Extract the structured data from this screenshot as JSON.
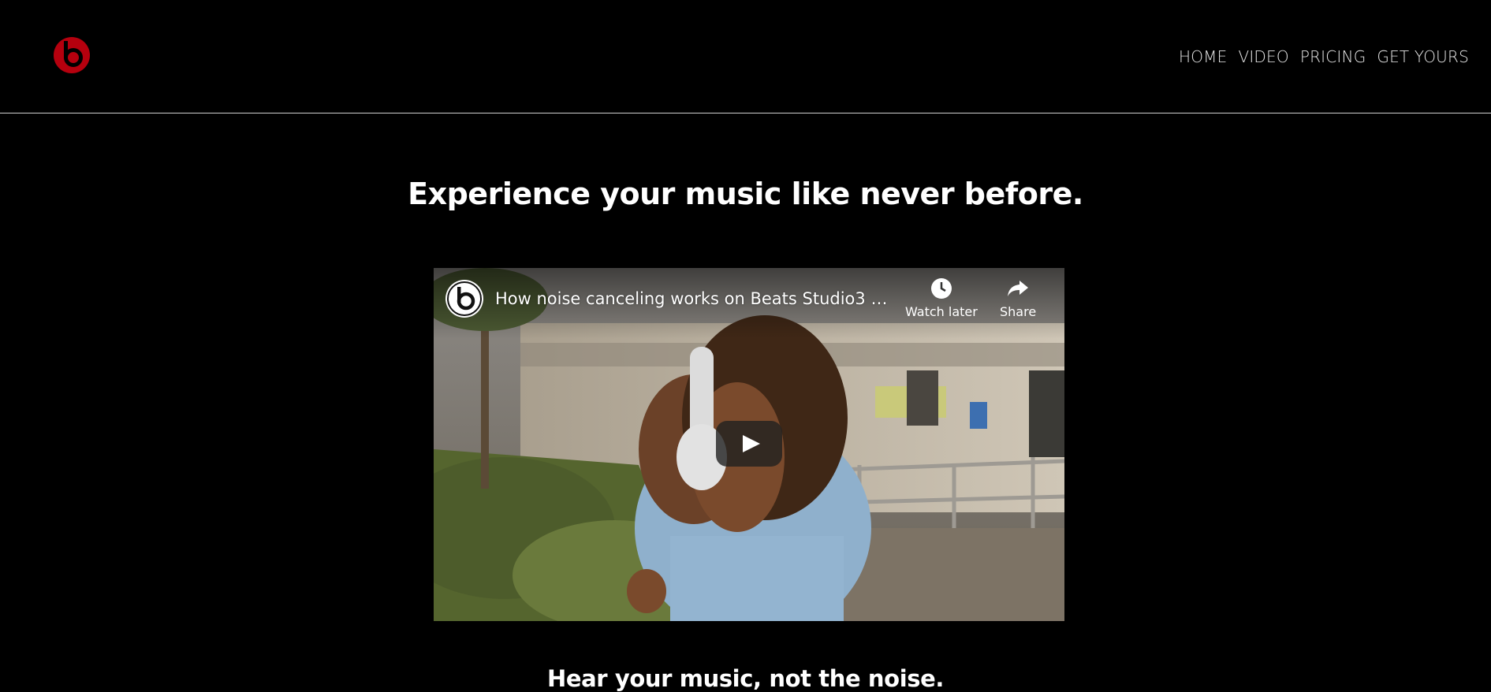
{
  "brand": {
    "logo": "beats-logo-icon",
    "color": "#b5000e"
  },
  "nav": {
    "items": [
      {
        "label": "HOME"
      },
      {
        "label": "VIDEO"
      },
      {
        "label": "PRICING"
      },
      {
        "label": "GET YOURS"
      }
    ]
  },
  "hero": {
    "title": "Experience your music like never before."
  },
  "video": {
    "title": "How noise canceling works on Beats Studio3 Wir...",
    "watch_later_label": "Watch later",
    "share_label": "Share",
    "icons": {
      "channel": "beats-logo-icon",
      "watch_later": "clock-icon",
      "share": "share-arrow-icon",
      "play": "play-icon"
    }
  },
  "section": {
    "subtitle": "Hear your music, not the noise."
  }
}
